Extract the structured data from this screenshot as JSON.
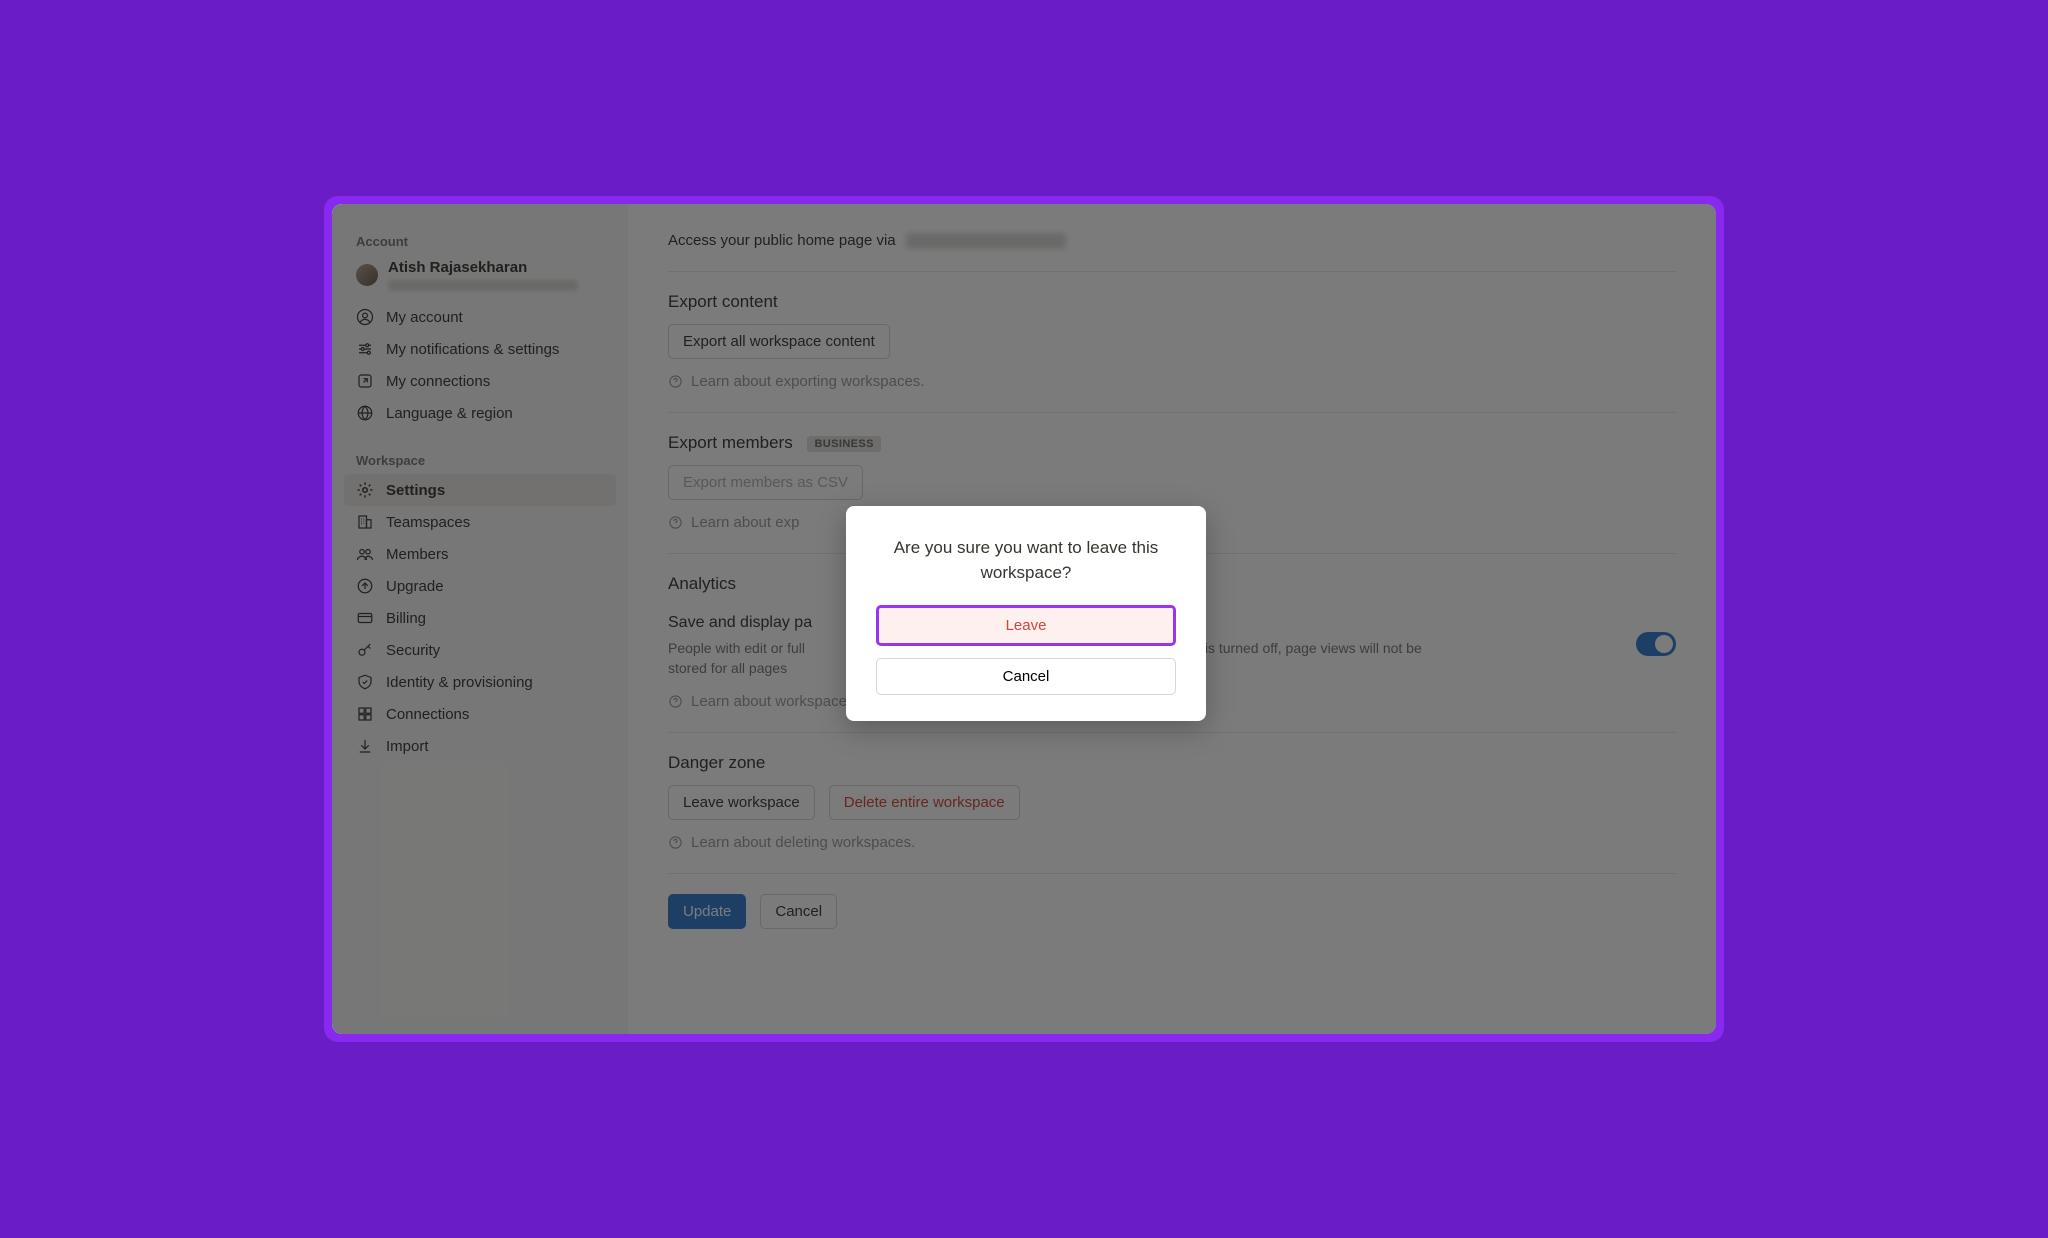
{
  "sidebar": {
    "account_header": "Account",
    "user_name": "Atish Rajasekharan",
    "items_account": [
      {
        "label": "My account"
      },
      {
        "label": "My notifications & settings"
      },
      {
        "label": "My connections"
      },
      {
        "label": "Language & region"
      }
    ],
    "workspace_header": "Workspace",
    "items_workspace": [
      {
        "label": "Settings"
      },
      {
        "label": "Teamspaces"
      },
      {
        "label": "Members"
      },
      {
        "label": "Upgrade"
      },
      {
        "label": "Billing"
      },
      {
        "label": "Security"
      },
      {
        "label": "Identity & provisioning"
      },
      {
        "label": "Connections"
      },
      {
        "label": "Import"
      }
    ]
  },
  "main": {
    "public_access_label": "Access your public home page via",
    "export_content": {
      "title": "Export content",
      "button": "Export all workspace content",
      "learn": "Learn about exporting workspaces."
    },
    "export_members": {
      "title": "Export members",
      "badge": "BUSINESS",
      "button": "Export members as CSV",
      "learn": "Learn about exp"
    },
    "analytics": {
      "title": "Analytics",
      "sub_title": "Save and display pa",
      "desc_before": "People with edit or full",
      "desc_after": "s. If this is turned off, page views will not be stored for all pages",
      "learn": "Learn about workspace analytics."
    },
    "danger": {
      "title": "Danger zone",
      "leave_button": "Leave workspace",
      "delete_button": "Delete entire workspace",
      "learn": "Learn about deleting workspaces."
    },
    "footer": {
      "update": "Update",
      "cancel": "Cancel"
    }
  },
  "modal": {
    "title": "Are you sure you want to leave this workspace?",
    "leave": "Leave",
    "cancel": "Cancel"
  }
}
